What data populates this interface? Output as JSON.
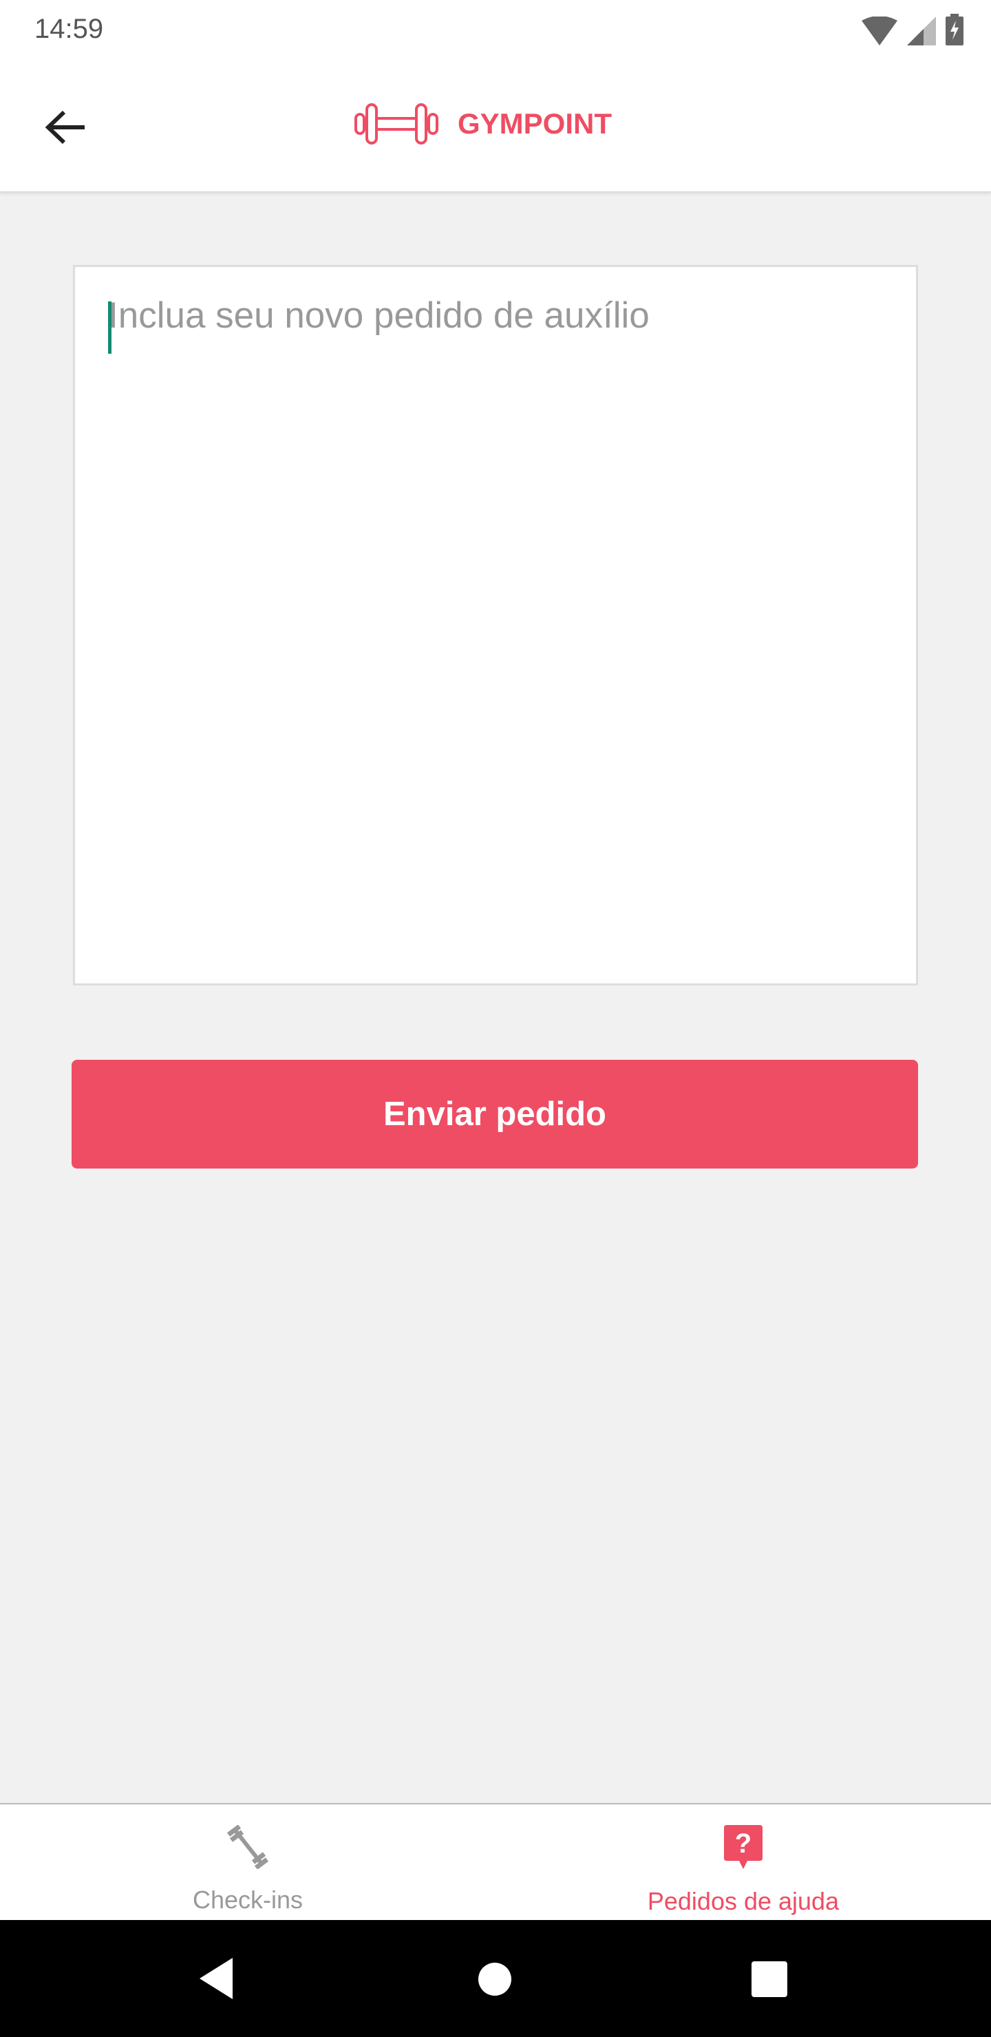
{
  "status_bar": {
    "time": "14:59"
  },
  "header": {
    "title": "GYMPOINT",
    "back_icon": "arrow-left-icon",
    "logo_icon": "dumbbell-icon"
  },
  "form": {
    "placeholder": "Inclua seu novo pedido de auxílio",
    "value": "",
    "submit_label": "Enviar pedido"
  },
  "tabs": [
    {
      "label": "Check-ins",
      "icon": "dumbbell-icon",
      "active": false
    },
    {
      "label": "Pedidos de ajuda",
      "icon": "help-bubble-icon",
      "active": true
    }
  ],
  "colors": {
    "accent": "#ee4d64",
    "inactive": "#999999"
  }
}
